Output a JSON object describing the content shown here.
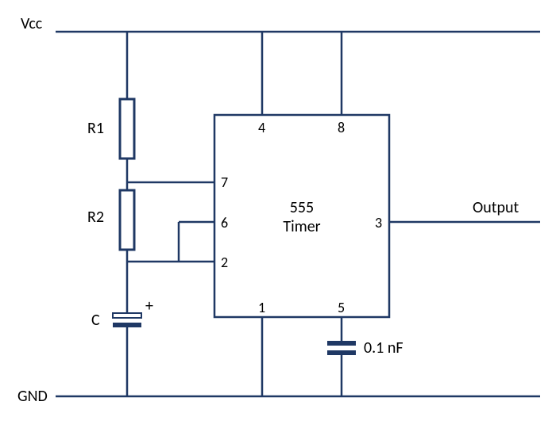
{
  "rails": {
    "vcc": "Vcc",
    "gnd": "GND"
  },
  "components": {
    "r1": "R1",
    "r2": "R2",
    "c": "C",
    "c_plus": "+",
    "c2_value": "0.1 nF"
  },
  "ic": {
    "name_line1": "555",
    "name_line2": "Timer",
    "pins": {
      "p1": "1",
      "p2": "2",
      "p3": "3",
      "p4": "4",
      "p5": "5",
      "p6": "6",
      "p7": "7",
      "p8": "8"
    }
  },
  "output_label": "Output"
}
